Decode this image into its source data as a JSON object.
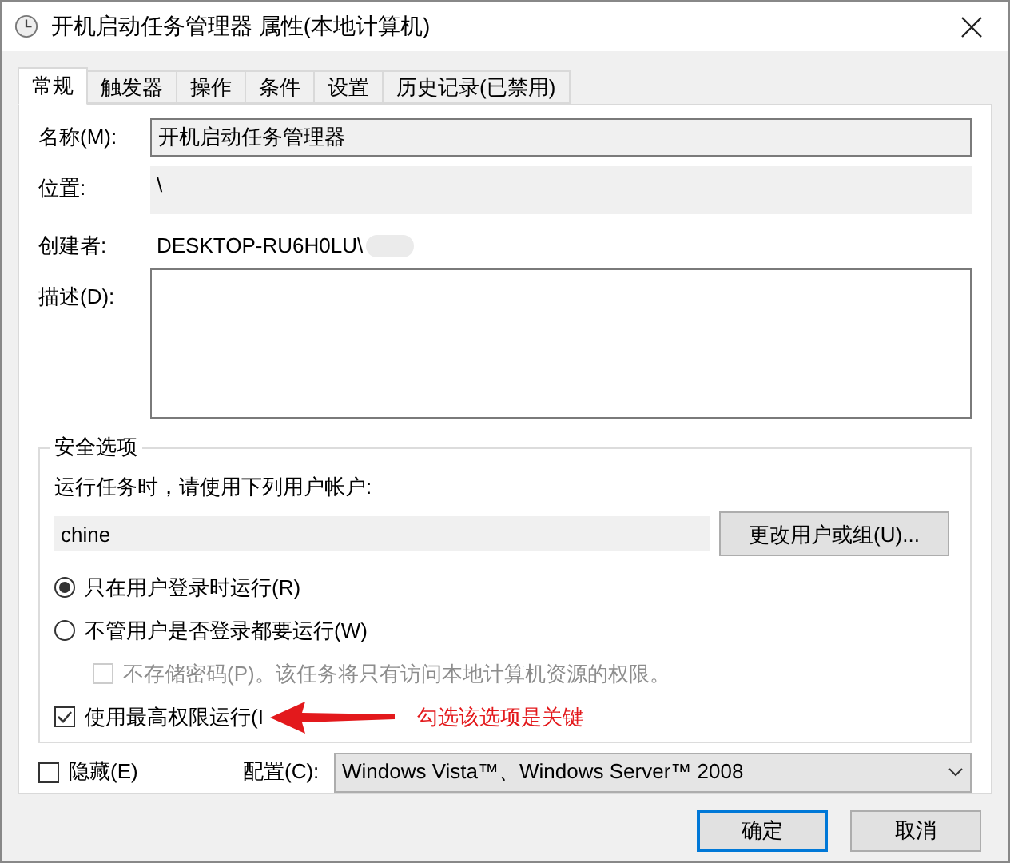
{
  "window": {
    "title": "开机启动任务管理器 属性(本地计算机)"
  },
  "tabs": [
    {
      "label": "常规",
      "selected": true
    },
    {
      "label": "触发器",
      "selected": false
    },
    {
      "label": "操作",
      "selected": false
    },
    {
      "label": "条件",
      "selected": false
    },
    {
      "label": "设置",
      "selected": false
    },
    {
      "label": "历史记录(已禁用)",
      "selected": false
    }
  ],
  "general": {
    "name_label": "名称(M):",
    "name_value": "开机启动任务管理器",
    "location_label": "位置:",
    "location_value": "\\",
    "author_label": "创建者:",
    "author_value": "DESKTOP-RU6H0LU\\",
    "description_label": "描述(D):"
  },
  "security": {
    "title": "安全选项",
    "account_prompt": "运行任务时，请使用下列用户帐户:",
    "account_value": "chine",
    "change_button": "更改用户或组(U)...",
    "options": [
      {
        "kind": "radio",
        "label": "只在用户登录时运行(R)",
        "selected": true,
        "disabled": false
      },
      {
        "kind": "radio",
        "label": "不管用户是否登录都要运行(W)",
        "selected": false,
        "disabled": false,
        "children": [
          {
            "kind": "checkbox",
            "label": "不存储密码(P)。该任务将只有访问本地计算机资源的权限。",
            "checked": false,
            "disabled": true
          }
        ]
      },
      {
        "kind": "checkbox",
        "label": "使用最高权限运行(I",
        "checked": true,
        "disabled": false
      }
    ],
    "annotation": "勾选该选项是关键"
  },
  "hidden": {
    "label": "隐藏(E)",
    "checked": false
  },
  "config": {
    "label": "配置(C):",
    "value": "Windows Vista™、Windows Server™ 2008"
  },
  "buttons": [
    {
      "label": "确定",
      "default": true
    },
    {
      "label": "取消",
      "default": false
    }
  ]
}
